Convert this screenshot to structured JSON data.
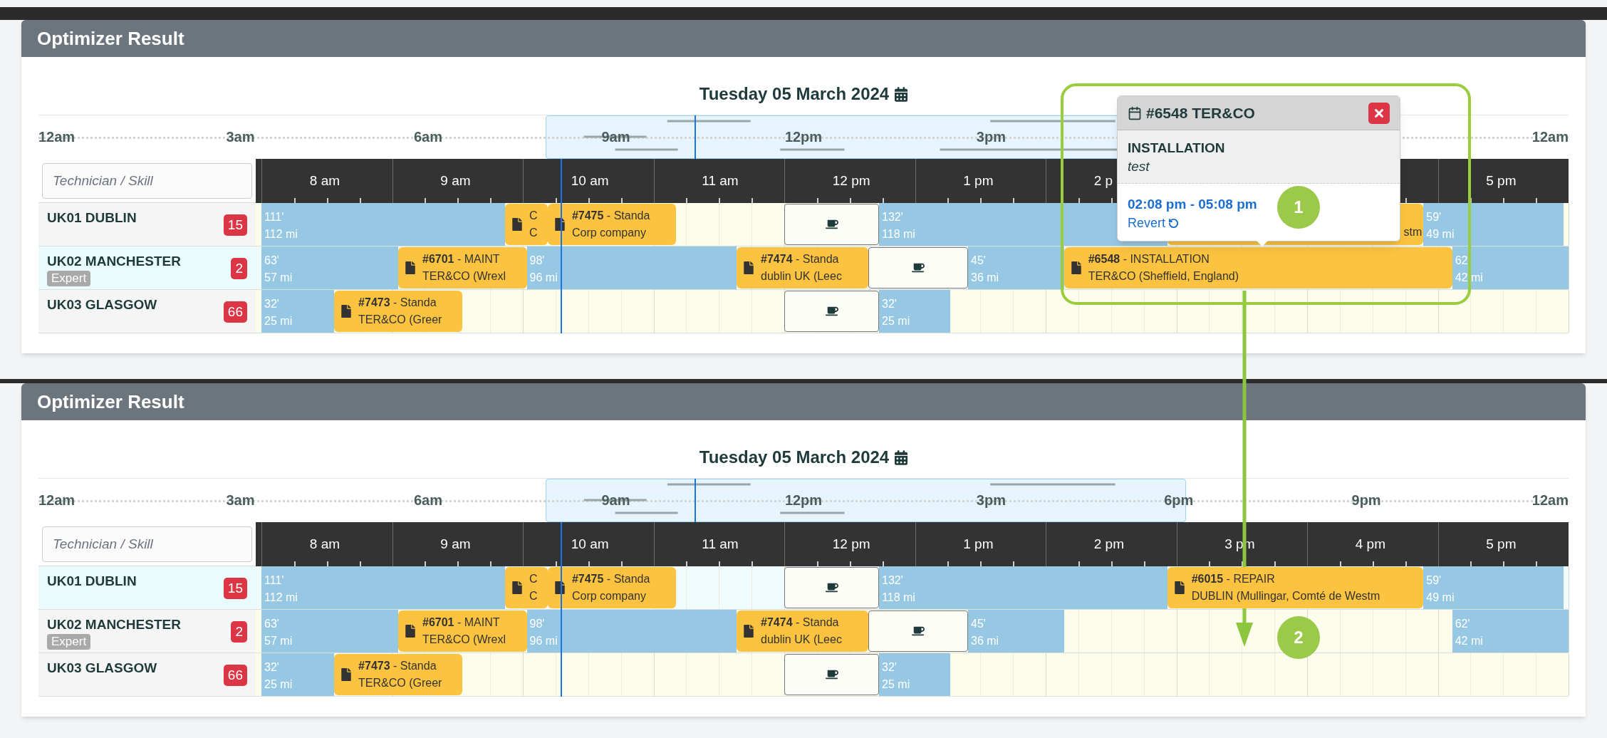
{
  "panels": [
    {
      "title": "Optimizer Result",
      "date": "Tuesday 05 March 2024",
      "overview": {
        "labels": [
          "12am",
          "3am",
          "6am",
          "9am",
          "12pm",
          "3pm",
          "12am"
        ]
      },
      "search": {
        "placeholder": "Technician / Skill"
      },
      "hours": [
        "8 am",
        "9 am",
        "10 am",
        "11 am",
        "12 pm",
        "1 pm",
        "2 p",
        "5 pm"
      ],
      "rows": [
        {
          "name": "UK01 DUBLIN",
          "count": "15",
          "selected": false,
          "items": [
            {
              "kind": "travel",
              "duration": "111'",
              "distance": "112 mi"
            },
            {
              "kind": "job",
              "title": "C",
              "place": "C"
            },
            {
              "kind": "job",
              "title": "**#7475** - Standa",
              "place": "Corp company"
            },
            {
              "kind": "break"
            },
            {
              "kind": "travel",
              "duration": "132'",
              "distance": "118 mi"
            },
            {
              "kind": "covered_job",
              "tail": "stm"
            },
            {
              "kind": "travel",
              "duration": "59'",
              "distance": "49 mi"
            }
          ]
        },
        {
          "name": "UK02 MANCHESTER",
          "skill": "Expert",
          "count": "2",
          "selected": true,
          "items": [
            {
              "kind": "travel",
              "duration": "63'",
              "distance": "57 mi"
            },
            {
              "kind": "job",
              "title": "**#6701** - MAINT",
              "place": "TER&CO (Wrexl"
            },
            {
              "kind": "travel",
              "duration": "98'",
              "distance": "96 mi"
            },
            {
              "kind": "job",
              "title": "**#7474** - Standa",
              "place": "dublin UK (Leec"
            },
            {
              "kind": "break"
            },
            {
              "kind": "travel",
              "duration": "45'",
              "distance": "36 mi"
            },
            {
              "kind": "job",
              "title": "**#6548** - INSTALLATION",
              "place": "TER&CO (Sheffield, England)"
            },
            {
              "kind": "travel",
              "duration": "62'",
              "distance": "42 mi"
            }
          ]
        },
        {
          "name": "UK03 GLASGOW",
          "count": "66",
          "selected": false,
          "items": [
            {
              "kind": "travel",
              "duration": "32'",
              "distance": "25 mi"
            },
            {
              "kind": "job",
              "title": "**#7473** - Standa",
              "place": "TER&CO (Greer"
            },
            {
              "kind": "break"
            },
            {
              "kind": "travel",
              "duration": "32'",
              "distance": "25 mi"
            }
          ]
        }
      ]
    },
    {
      "title": "Optimizer Result",
      "date": "Tuesday 05 March 2024",
      "overview": {
        "labels": [
          "12am",
          "3am",
          "6am",
          "9am",
          "12pm",
          "3pm",
          "6pm",
          "9pm",
          "12am"
        ]
      },
      "search": {
        "placeholder": "Technician / Skill"
      },
      "hours": [
        "8 am",
        "9 am",
        "10 am",
        "11 am",
        "12 pm",
        "1 pm",
        "2 pm",
        "3 pm",
        "4 pm",
        "5 pm"
      ],
      "rows": [
        {
          "name": "UK01 DUBLIN",
          "count": "15",
          "selected": true,
          "items": [
            {
              "kind": "travel",
              "duration": "111'",
              "distance": "112 mi"
            },
            {
              "kind": "job",
              "title": "C",
              "place": "C"
            },
            {
              "kind": "job",
              "title": "**#7475** - Standa",
              "place": "Corp company"
            },
            {
              "kind": "break"
            },
            {
              "kind": "travel",
              "duration": "132'",
              "distance": "118 mi"
            },
            {
              "kind": "job",
              "title": "**#6015** - REPAIR",
              "place": "DUBLIN (Mullingar, Comté de Westm"
            },
            {
              "kind": "travel",
              "duration": "59'",
              "distance": "49 mi"
            }
          ]
        },
        {
          "name": "UK02 MANCHESTER",
          "skill": "Expert",
          "count": "2",
          "selected": false,
          "items": [
            {
              "kind": "travel",
              "duration": "63'",
              "distance": "57 mi"
            },
            {
              "kind": "job",
              "title": "**#6701** - MAINT",
              "place": "TER&CO (Wrexl"
            },
            {
              "kind": "travel",
              "duration": "98'",
              "distance": "96 mi"
            },
            {
              "kind": "job",
              "title": "**#7474** - Standa",
              "place": "dublin UK (Leec"
            },
            {
              "kind": "break"
            },
            {
              "kind": "travel",
              "duration": "45'",
              "distance": "36 mi"
            },
            {
              "kind": "travel",
              "duration": "62'",
              "distance": "42 mi"
            }
          ]
        },
        {
          "name": "UK03 GLASGOW",
          "count": "66",
          "selected": false,
          "items": [
            {
              "kind": "travel",
              "duration": "32'",
              "distance": "25 mi"
            },
            {
              "kind": "job",
              "title": "**#7473** - Standa",
              "place": "TER&CO (Greer"
            },
            {
              "kind": "break"
            },
            {
              "kind": "travel",
              "duration": "32'",
              "distance": "25 mi"
            }
          ]
        }
      ]
    }
  ],
  "popup": {
    "title": "#6548 TER&CO",
    "type": "INSTALLATION",
    "note": "test",
    "time": "02:08 pm - 05:08 pm",
    "action": "Revert"
  },
  "markers": [
    "1",
    "2"
  ]
}
